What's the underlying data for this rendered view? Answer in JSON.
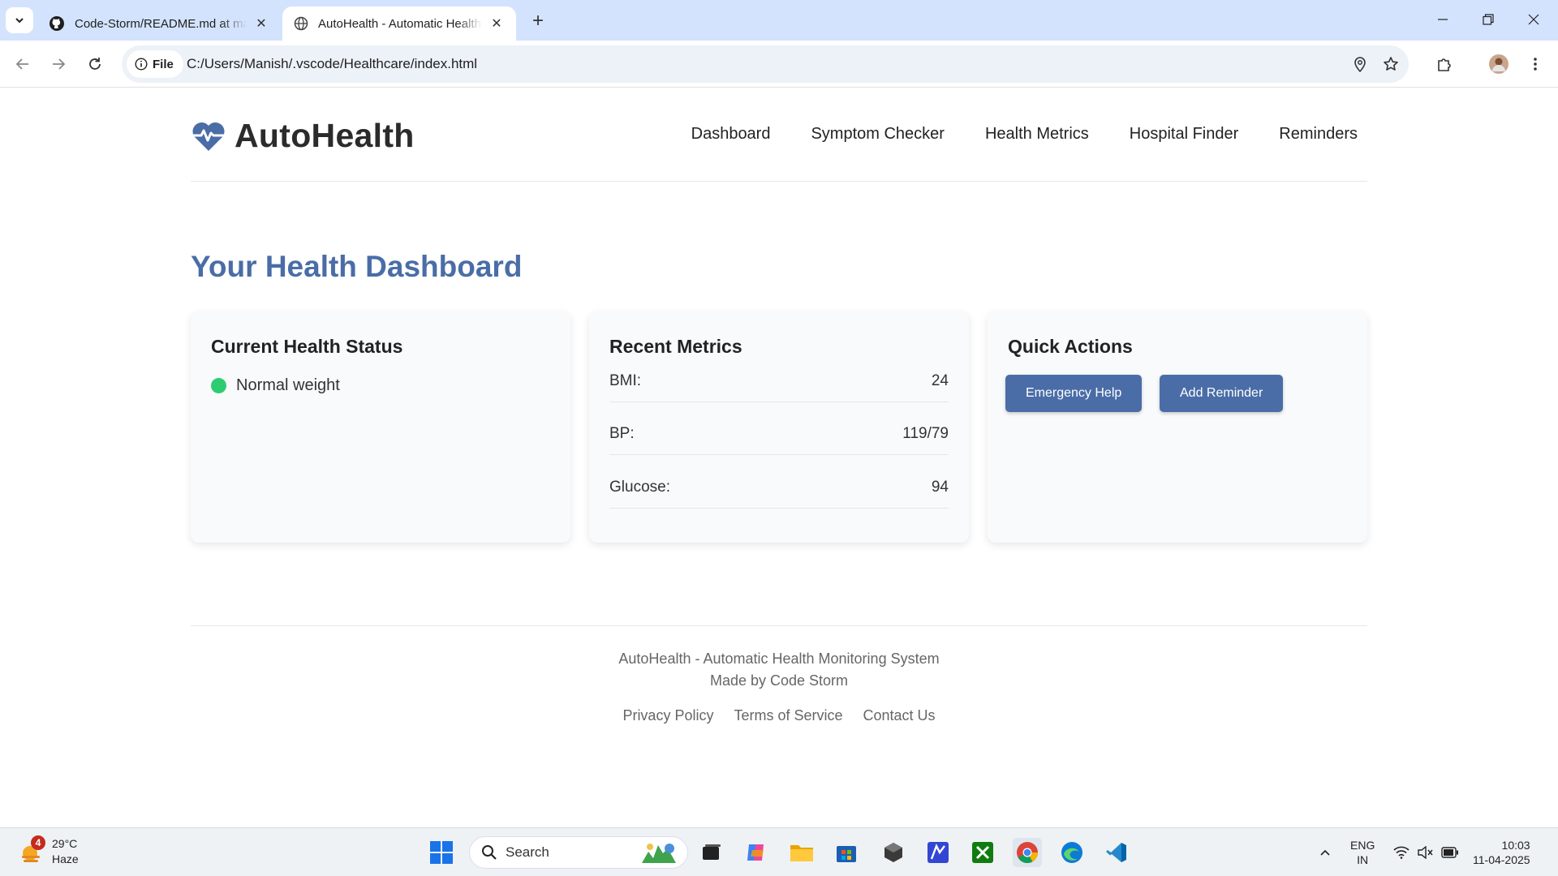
{
  "browser": {
    "tabs": [
      {
        "title": "Code-Storm/README.md at main"
      },
      {
        "title": "AutoHealth - Automatic Health Monitoring System"
      }
    ],
    "file_chip": "File",
    "url": "C:/Users/Manish/.vscode/Healthcare/index.html"
  },
  "site": {
    "logo": "AutoHealth",
    "nav": [
      "Dashboard",
      "Symptom Checker",
      "Health Metrics",
      "Hospital Finder",
      "Reminders"
    ]
  },
  "dashboard": {
    "title": "Your Health Dashboard",
    "status_card": {
      "title": "Current Health Status",
      "status": "Normal weight",
      "status_color": "#2ecc71"
    },
    "metrics_card": {
      "title": "Recent Metrics",
      "rows": [
        {
          "label": "BMI:",
          "value": "24"
        },
        {
          "label": "BP:",
          "value": "119/79"
        },
        {
          "label": "Glucose:",
          "value": "94"
        }
      ]
    },
    "actions_card": {
      "title": "Quick Actions",
      "buttons": [
        "Emergency Help",
        "Add Reminder"
      ]
    }
  },
  "footer": {
    "line1": "AutoHealth - Automatic Health Monitoring System",
    "line2": "Made by Code Storm",
    "links": [
      "Privacy Policy",
      "Terms of Service",
      "Contact Us"
    ]
  },
  "taskbar": {
    "weather": {
      "badge": "4",
      "temp": "29°C",
      "condition": "Haze"
    },
    "search_placeholder": "Search",
    "lang": {
      "line1": "ENG",
      "line2": "IN"
    },
    "clock": {
      "time": "10:03",
      "date": "11-04-2025"
    }
  },
  "colors": {
    "brand": "#4a6da7",
    "status_ok": "#2ecc71",
    "tab_strip": "#d3e3fd"
  }
}
